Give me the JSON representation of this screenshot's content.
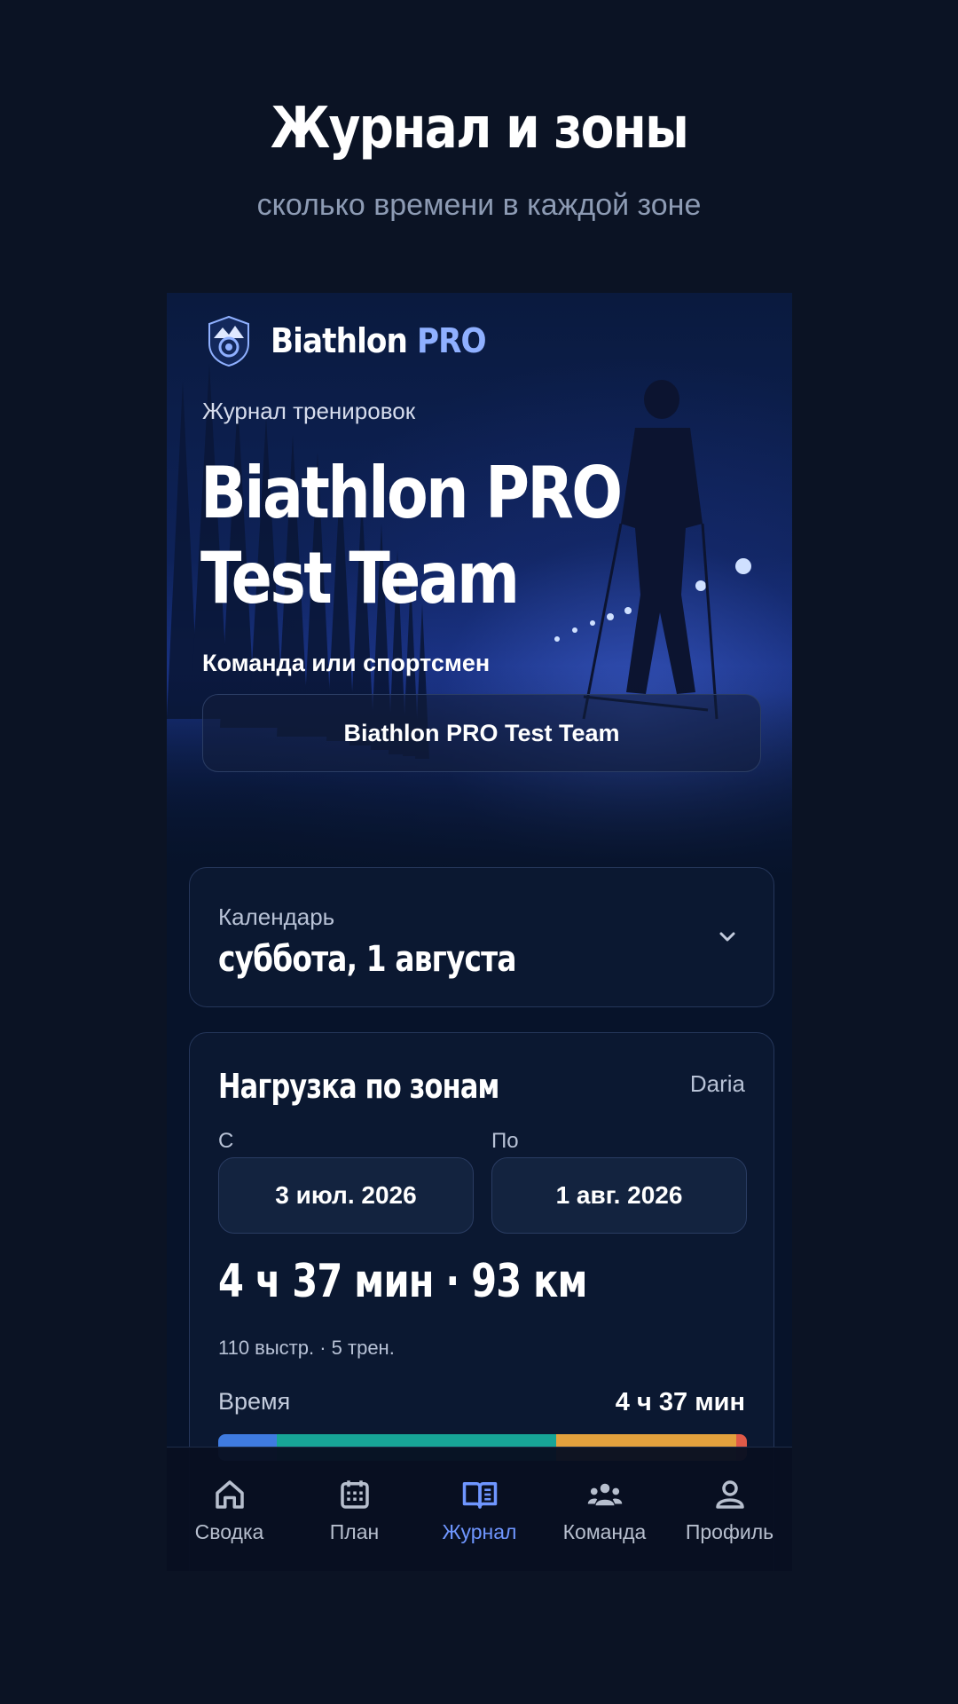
{
  "promo": {
    "title": "Журнал и зоны",
    "subtitle": "сколько времени в каждой зоне"
  },
  "brand": {
    "name": "Biathlon",
    "pro": "PRO"
  },
  "hero": {
    "journal_label": "Журнал тренировок",
    "team_title": "Biathlon PRO Test Team",
    "team_field_label": "Команда или спортсмен",
    "team_value": "Biathlon PRO Test Team"
  },
  "calendar": {
    "label": "Календарь",
    "date": "суббота, 1 августа",
    "icon": "chevron-down-icon"
  },
  "zones": {
    "title": "Нагрузка по зонам",
    "user": "Daria",
    "from_label": "С",
    "to_label": "По",
    "from_date": "3 июл. 2026",
    "to_date": "1 авг. 2026",
    "totals": "4 ч 37 мин · 93 км",
    "counts": "110 выстр. · 5 трен.",
    "time_label": "Время",
    "time_value": "4 ч 37 мин",
    "bar_segments": [
      {
        "color": "#3f7be0",
        "fraction": 0.11
      },
      {
        "color": "#17a597",
        "fraction": 0.53
      },
      {
        "color": "#e3a13d",
        "fraction": 0.34
      },
      {
        "color": "#e05a48",
        "fraction": 0.02
      }
    ]
  },
  "nav": {
    "items": [
      {
        "label": "Сводка",
        "icon": "home-icon"
      },
      {
        "label": "План",
        "icon": "calendar-icon"
      },
      {
        "label": "Журнал",
        "icon": "book-icon"
      },
      {
        "label": "Команда",
        "icon": "team-icon"
      },
      {
        "label": "Профиль",
        "icon": "profile-icon"
      }
    ],
    "active_index": 2
  },
  "colors": {
    "background": "#0b1324",
    "accent": "#6f96ff",
    "card": "#0b1831"
  }
}
